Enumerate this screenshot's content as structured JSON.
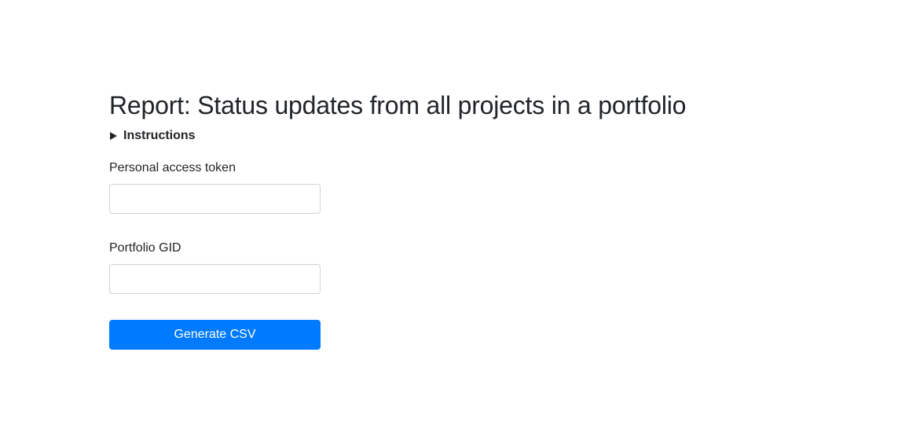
{
  "page": {
    "title": "Report: Status updates from all projects in a portfolio"
  },
  "instructions": {
    "label": "Instructions",
    "icon": "triangle-right-icon"
  },
  "form": {
    "token": {
      "label": "Personal access token",
      "value": "",
      "placeholder": ""
    },
    "portfolio": {
      "label": "Portfolio GID",
      "value": "",
      "placeholder": ""
    },
    "submit_label": "Generate CSV"
  },
  "colors": {
    "primary": "#007bff",
    "text": "#212529",
    "input_border": "#ced4da"
  }
}
